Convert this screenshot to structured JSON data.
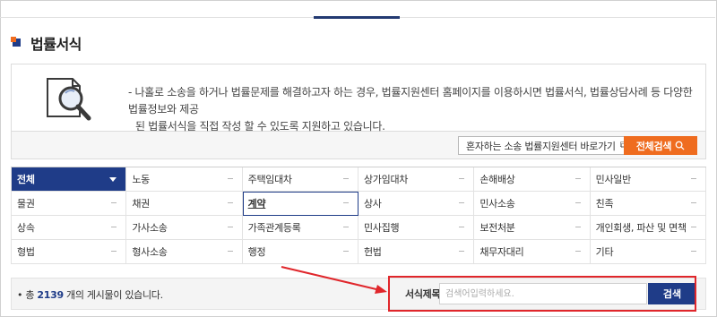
{
  "page": {
    "title": "법률서식"
  },
  "intro": {
    "icon": "document-magnifier-icon",
    "text_line1": "- 나홀로 소송을 하거나 법률문제를 해결하고자 하는 경우, 법률지원센터 홈페이지를 이용하시면 법률서식, 법률상담사례 등 다양한 법률정보와 제공",
    "text_line2": "된 법률서식을 직접 작성 할 수 있도록 지원하고 있습니다."
  },
  "buttons": {
    "guide_label": "혼자하는 소송 법률지원센터 바로가기",
    "guide_icon": "external-link-icon",
    "search_all_label": "전체검색",
    "search_all_icon": "search-icon"
  },
  "categories": [
    "전체",
    "노동",
    "주택임대차",
    "상가임대차",
    "손해배상",
    "민사일반",
    "물권",
    "채권",
    "계약",
    "상사",
    "민사소송",
    "친족",
    "상속",
    "가사소송",
    "가족관계등록",
    "민사집행",
    "보전처분",
    "개인회생, 파산 및 면책",
    "형법",
    "형사소송",
    "행정",
    "헌법",
    "채무자대리",
    "기타"
  ],
  "active_category": "전체",
  "selected_category": "계약",
  "list_info": {
    "prefix": "• 총 ",
    "count": "2139",
    "suffix": " 개의 게시물이 있습니다."
  },
  "search": {
    "label": "서식제목",
    "placeholder": "검색어입력하세요.",
    "button_label": "검색"
  },
  "colors": {
    "navy": "#1f3c88",
    "orange": "#ef6c1f",
    "annotation_red": "#e0262b"
  }
}
